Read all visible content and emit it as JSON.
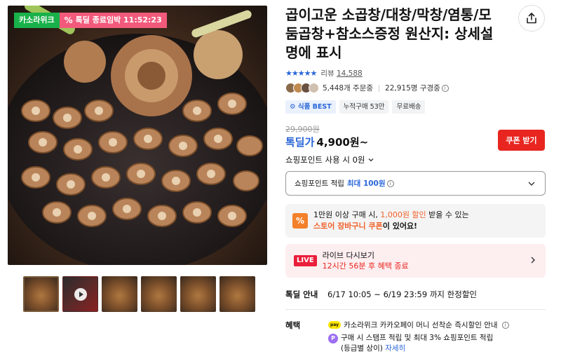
{
  "product": {
    "title": "곱이고운 소곱창/대창/막창/염통/모둠곱창+참소스증정 원산지: 상세설명에 표시"
  },
  "gallery": {
    "store_badge": "카소라위크",
    "deadline_badge_icon": "%",
    "deadline_badge_label": "톡딜 종료임박 11:52:23",
    "thumbnail_count": 6
  },
  "rating": {
    "stars": "★★★★★",
    "review_label": "리뷰",
    "review_count": "14,588"
  },
  "buyers": {
    "orders": "5,448개 주문중",
    "subscribers": "22,915명 구경중"
  },
  "tags": [
    "식품 BEST",
    "누적구매 53만",
    "무료배송"
  ],
  "price": {
    "original": "29,900원",
    "label": "톡딜가",
    "value": "4,900원~",
    "coupon_button": "쿠폰 받기"
  },
  "points": {
    "use_label": "쇼핑포인트 사용 시 0원",
    "accrual_label": "쇼핑포인트 적립",
    "accrual_value": "최대 100원"
  },
  "cart_coupon": {
    "icon": "%",
    "line1_prefix": "1만원 이상 구매 시, ",
    "line1_amount": "1,000원 할인",
    "line1_suffix": " 받을 수 있는",
    "line2_highlight": "스토어 장바구니 쿠폰",
    "line2_suffix": "이 있어요!"
  },
  "live": {
    "badge": "LIVE",
    "title": "라이브 다시보기",
    "subtitle": "12시간 56분 후 혜택 종료"
  },
  "deal": {
    "label": "톡딜 안내",
    "period": "6/17 10:05 ~ 6/19 23:59 까지 한정할인"
  },
  "benefits": {
    "label": "혜택",
    "pay_icon_text": "pay",
    "item1": "카소라위크 카카오페이 머니 선착순 즉시할인 안내",
    "p_icon_text": "P",
    "item2_line1": "구매 시 스탬프 적립 및 최대 3% 쇼핑포인트 적립",
    "item2_line2": "(등급별 상이)",
    "item2_link": "자세히"
  },
  "colors": {
    "accent_blue": "#2a66d9",
    "coupon_red": "#e8261f",
    "store_green": "#19b14a",
    "deadline_pink": "#f25a7c"
  }
}
